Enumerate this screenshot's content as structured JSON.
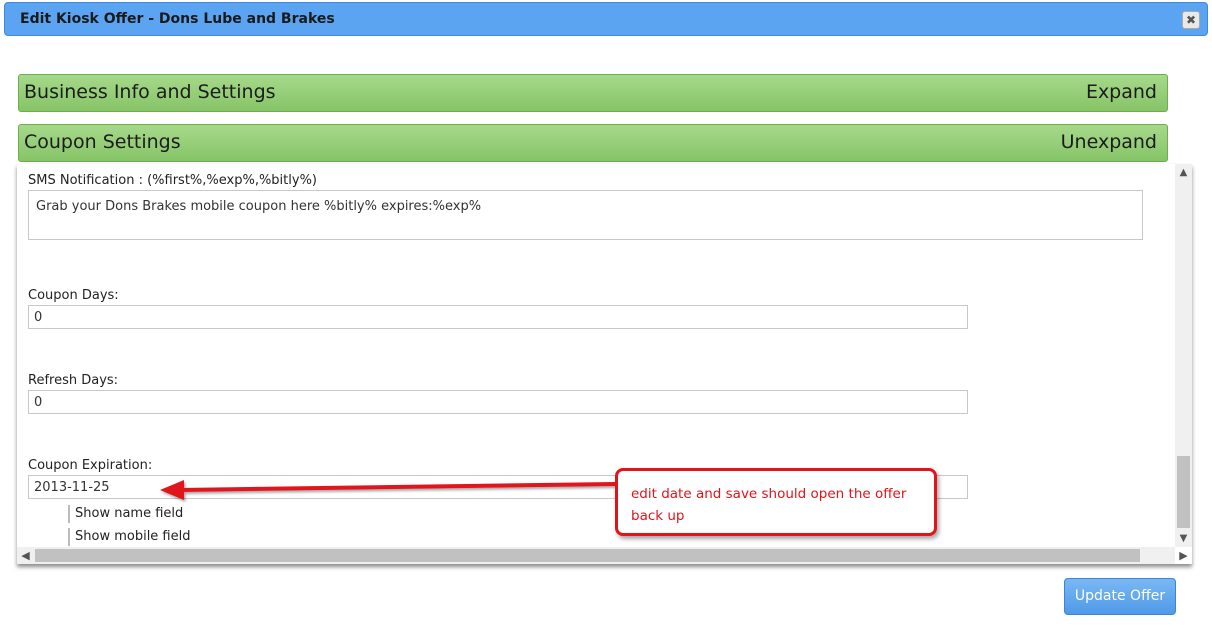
{
  "window": {
    "title": "Edit Kiosk Offer - Dons Lube and Brakes",
    "close_glyph": "✖"
  },
  "sections": [
    {
      "title": "Business Info and Settings",
      "toggle": "Expand"
    },
    {
      "title": "Coupon Settings",
      "toggle": "Unexpand"
    }
  ],
  "form": {
    "sms_label": "SMS Notification : (%first%,%exp%,%bitly%)",
    "sms_value": "Grab your Dons Brakes mobile coupon here %bitly% expires:%exp%",
    "coupon_days_label": "Coupon Days:",
    "coupon_days_value": "0",
    "refresh_days_label": "Refresh Days:",
    "refresh_days_value": "0",
    "coupon_expiration_label": "Coupon Expiration:",
    "coupon_expiration_value": "2013-11-25",
    "options": [
      {
        "label": "Show name field"
      },
      {
        "label": "Show mobile field"
      }
    ]
  },
  "annotation": {
    "text": "edit date and save should open the offer back up",
    "color": "#e0141b"
  },
  "footer": {
    "update_label": "Update Offer"
  },
  "colors": {
    "titlebar": "#5ba4f2",
    "section_header": "#8fca70",
    "primary_button": "#5aa0ee"
  }
}
